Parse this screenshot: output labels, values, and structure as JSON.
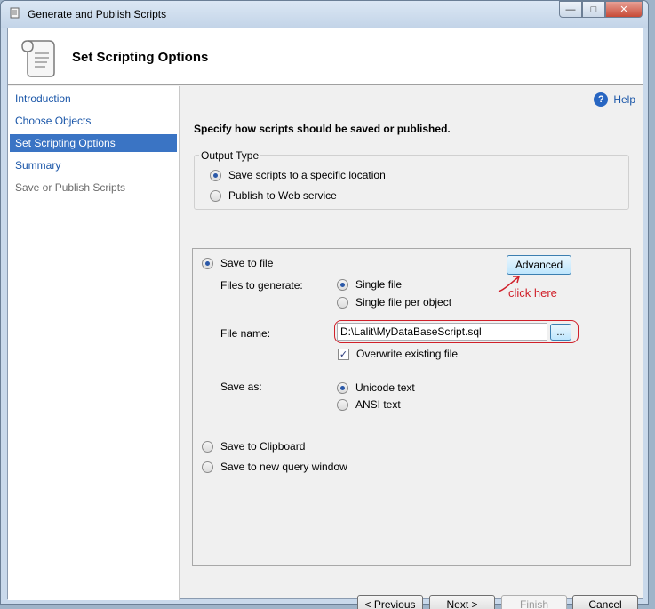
{
  "window": {
    "title": "Generate and Publish Scripts"
  },
  "header": {
    "title": "Set Scripting Options"
  },
  "nav": {
    "items": [
      {
        "label": "Introduction"
      },
      {
        "label": "Choose Objects"
      },
      {
        "label": "Set Scripting Options"
      },
      {
        "label": "Summary"
      },
      {
        "label": "Save or Publish Scripts"
      }
    ]
  },
  "help": {
    "label": "Help"
  },
  "main": {
    "instruction": "Specify how scripts should be saved or published.",
    "output_type": {
      "legend": "Output Type",
      "options": [
        {
          "label": "Save scripts to a specific location",
          "selected": true
        },
        {
          "label": "Publish to Web service",
          "selected": false
        }
      ]
    },
    "save_to_file": {
      "label": "Save to file",
      "advanced_label": "Advanced",
      "files_to_generate_label": "Files to generate:",
      "files_options": [
        {
          "label": "Single file",
          "selected": true
        },
        {
          "label": "Single file per object",
          "selected": false
        }
      ],
      "file_name_label": "File name:",
      "file_name_value": "D:\\Lalit\\MyDataBaseScript.sql",
      "browse_label": "...",
      "overwrite_label": "Overwrite existing file",
      "overwrite_checked": true,
      "save_as_label": "Save as:",
      "save_as_options": [
        {
          "label": "Unicode text",
          "selected": true
        },
        {
          "label": "ANSI text",
          "selected": false
        }
      ]
    },
    "clipboard_label": "Save to Clipboard",
    "query_window_label": "Save to new query window",
    "annotation": "click here"
  },
  "footer": {
    "previous": "< Previous",
    "next": "Next >",
    "finish": "Finish",
    "cancel": "Cancel"
  },
  "colors": {
    "accent": "#3a74c4",
    "annotation": "#d0202a"
  }
}
